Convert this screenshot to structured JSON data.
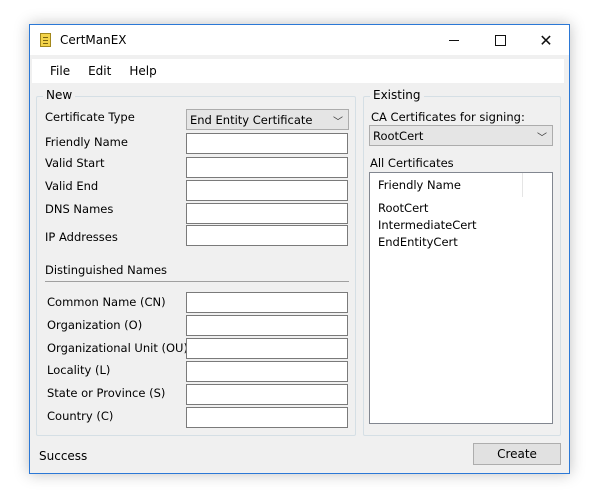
{
  "window": {
    "title": "CertManEX"
  },
  "menu": {
    "file": "File",
    "edit": "Edit",
    "help": "Help"
  },
  "new_group": {
    "title": "New",
    "certificate_type_label": "Certificate Type",
    "certificate_type_value": "End Entity Certificate",
    "friendly_name_label": "Friendly Name",
    "valid_start_label": "Valid Start",
    "valid_end_label": "Valid End",
    "dns_names_label": "DNS Names",
    "ip_addresses_label": "IP Addresses",
    "distinguished_names_label": "Distinguished Names",
    "common_name_label": "Common Name (CN)",
    "organization_label": "Organization (O)",
    "org_unit_label": "Organizational Unit (OU)",
    "locality_label": "Locality (L)",
    "state_label": "State or Province (S)",
    "country_label": "Country (C)"
  },
  "existing_group": {
    "title": "Existing",
    "ca_label": "CA Certificates for signing:",
    "ca_value": "RootCert",
    "all_certs_label": "All Certificates",
    "column_header": "Friendly Name",
    "items": [
      "RootCert",
      "IntermediateCert",
      "EndEntityCert"
    ]
  },
  "status": {
    "text": "Success"
  },
  "buttons": {
    "create": "Create"
  }
}
